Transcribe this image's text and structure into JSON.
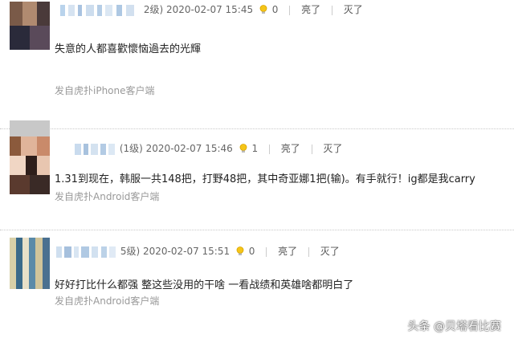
{
  "comments": [
    {
      "level": "2级)",
      "timestamp": "2020-02-07 15:45",
      "light_count": "0",
      "light_label": "亮了",
      "dislike_label": "灭了",
      "text": "失意的人都喜歡懷恼過去的光輝",
      "source": "发自虎扑iPhone客户端"
    },
    {
      "level": "(1级)",
      "timestamp": "2020-02-07 15:46",
      "light_count": "1",
      "light_label": "亮了",
      "dislike_label": "灭了",
      "text": "1.31到现在，韩服一共148把，打野48把，其中奇亚娜1把(输)。有手就行！ig都是我carry",
      "source": "发自虎扑Android客户端"
    },
    {
      "level": "5级)",
      "timestamp": "2020-02-07 15:51",
      "light_count": "0",
      "light_label": "亮了",
      "dislike_label": "灭了",
      "text": "好好打比什么都强 整这些没用的干啥 一看战绩和英雄啥都明白了",
      "source": "发自虎扑Android客户端"
    }
  ],
  "watermark": "头条 @贝塔看比赛",
  "colors": {
    "bulb": "#e8b400",
    "meta_text": "#666666",
    "source_text": "#999999"
  },
  "icons": {
    "light": "lightbulb-icon"
  }
}
